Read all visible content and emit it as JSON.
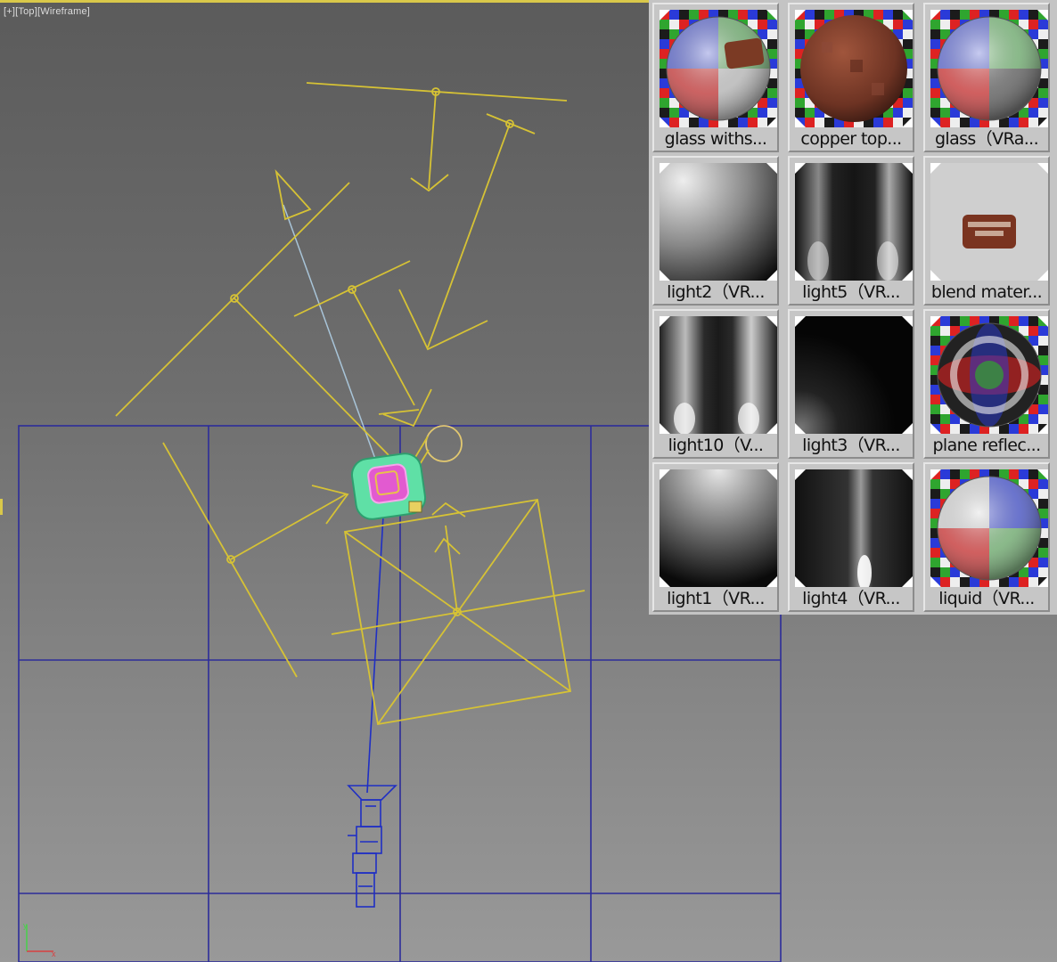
{
  "viewport": {
    "label": "[+][Top][Wireframe]"
  },
  "material_slots": [
    {
      "name": "glass withs...",
      "preview": "checker-sphere-label-icon"
    },
    {
      "name": "copper top...",
      "preview": "copper-sphere-icon"
    },
    {
      "name": "glass（VRa...",
      "preview": "checker-sphere-icon"
    },
    {
      "name": "light2（VR...",
      "preview": "gradient-corner-icon"
    },
    {
      "name": "light5（VR...",
      "preview": "gradient-dual-bars-icon"
    },
    {
      "name": "blend mater...",
      "preview": "label-patch-icon"
    },
    {
      "name": "light10（V...",
      "preview": "gradient-dual-bars-bright-icon"
    },
    {
      "name": "light3（VR...",
      "preview": "gradient-dark-corner-icon"
    },
    {
      "name": "plane reflec...",
      "preview": "reflective-sphere-icon"
    },
    {
      "name": "light1（VR...",
      "preview": "gradient-top-glow-icon"
    },
    {
      "name": "light4（VR...",
      "preview": "gradient-spot-icon"
    },
    {
      "name": "liquid（VR...",
      "preview": "checker-sphere-icon"
    }
  ],
  "colors": {
    "grid": "#2c2c9a",
    "light_wire": "#d6c235",
    "camera_wire": "#1f2fc4",
    "selected_object": "#5fe0a6",
    "frame_border": "#d9c84a"
  },
  "axis_gizmo": {
    "x": "x",
    "y": "y"
  }
}
